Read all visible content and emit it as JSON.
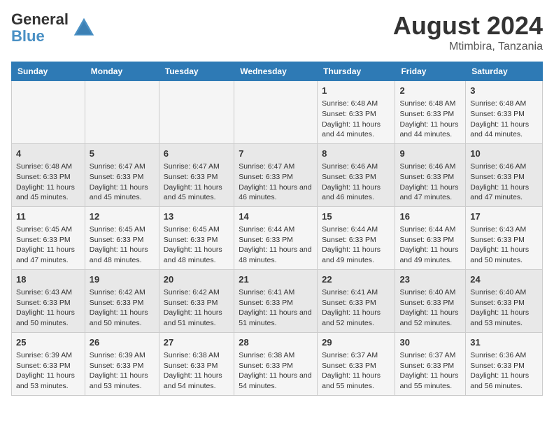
{
  "header": {
    "logo_line1": "General",
    "logo_line2": "Blue",
    "month_title": "August 2024",
    "location": "Mtimbira, Tanzania"
  },
  "days_of_week": [
    "Sunday",
    "Monday",
    "Tuesday",
    "Wednesday",
    "Thursday",
    "Friday",
    "Saturday"
  ],
  "weeks": [
    [
      {
        "day": "",
        "info": ""
      },
      {
        "day": "",
        "info": ""
      },
      {
        "day": "",
        "info": ""
      },
      {
        "day": "",
        "info": ""
      },
      {
        "day": "1",
        "info": "Sunrise: 6:48 AM\nSunset: 6:33 PM\nDaylight: 11 hours and 44 minutes."
      },
      {
        "day": "2",
        "info": "Sunrise: 6:48 AM\nSunset: 6:33 PM\nDaylight: 11 hours and 44 minutes."
      },
      {
        "day": "3",
        "info": "Sunrise: 6:48 AM\nSunset: 6:33 PM\nDaylight: 11 hours and 44 minutes."
      }
    ],
    [
      {
        "day": "4",
        "info": "Sunrise: 6:48 AM\nSunset: 6:33 PM\nDaylight: 11 hours and 45 minutes."
      },
      {
        "day": "5",
        "info": "Sunrise: 6:47 AM\nSunset: 6:33 PM\nDaylight: 11 hours and 45 minutes."
      },
      {
        "day": "6",
        "info": "Sunrise: 6:47 AM\nSunset: 6:33 PM\nDaylight: 11 hours and 45 minutes."
      },
      {
        "day": "7",
        "info": "Sunrise: 6:47 AM\nSunset: 6:33 PM\nDaylight: 11 hours and 46 minutes."
      },
      {
        "day": "8",
        "info": "Sunrise: 6:46 AM\nSunset: 6:33 PM\nDaylight: 11 hours and 46 minutes."
      },
      {
        "day": "9",
        "info": "Sunrise: 6:46 AM\nSunset: 6:33 PM\nDaylight: 11 hours and 47 minutes."
      },
      {
        "day": "10",
        "info": "Sunrise: 6:46 AM\nSunset: 6:33 PM\nDaylight: 11 hours and 47 minutes."
      }
    ],
    [
      {
        "day": "11",
        "info": "Sunrise: 6:45 AM\nSunset: 6:33 PM\nDaylight: 11 hours and 47 minutes."
      },
      {
        "day": "12",
        "info": "Sunrise: 6:45 AM\nSunset: 6:33 PM\nDaylight: 11 hours and 48 minutes."
      },
      {
        "day": "13",
        "info": "Sunrise: 6:45 AM\nSunset: 6:33 PM\nDaylight: 11 hours and 48 minutes."
      },
      {
        "day": "14",
        "info": "Sunrise: 6:44 AM\nSunset: 6:33 PM\nDaylight: 11 hours and 48 minutes."
      },
      {
        "day": "15",
        "info": "Sunrise: 6:44 AM\nSunset: 6:33 PM\nDaylight: 11 hours and 49 minutes."
      },
      {
        "day": "16",
        "info": "Sunrise: 6:44 AM\nSunset: 6:33 PM\nDaylight: 11 hours and 49 minutes."
      },
      {
        "day": "17",
        "info": "Sunrise: 6:43 AM\nSunset: 6:33 PM\nDaylight: 11 hours and 50 minutes."
      }
    ],
    [
      {
        "day": "18",
        "info": "Sunrise: 6:43 AM\nSunset: 6:33 PM\nDaylight: 11 hours and 50 minutes."
      },
      {
        "day": "19",
        "info": "Sunrise: 6:42 AM\nSunset: 6:33 PM\nDaylight: 11 hours and 50 minutes."
      },
      {
        "day": "20",
        "info": "Sunrise: 6:42 AM\nSunset: 6:33 PM\nDaylight: 11 hours and 51 minutes."
      },
      {
        "day": "21",
        "info": "Sunrise: 6:41 AM\nSunset: 6:33 PM\nDaylight: 11 hours and 51 minutes."
      },
      {
        "day": "22",
        "info": "Sunrise: 6:41 AM\nSunset: 6:33 PM\nDaylight: 11 hours and 52 minutes."
      },
      {
        "day": "23",
        "info": "Sunrise: 6:40 AM\nSunset: 6:33 PM\nDaylight: 11 hours and 52 minutes."
      },
      {
        "day": "24",
        "info": "Sunrise: 6:40 AM\nSunset: 6:33 PM\nDaylight: 11 hours and 53 minutes."
      }
    ],
    [
      {
        "day": "25",
        "info": "Sunrise: 6:39 AM\nSunset: 6:33 PM\nDaylight: 11 hours and 53 minutes."
      },
      {
        "day": "26",
        "info": "Sunrise: 6:39 AM\nSunset: 6:33 PM\nDaylight: 11 hours and 53 minutes."
      },
      {
        "day": "27",
        "info": "Sunrise: 6:38 AM\nSunset: 6:33 PM\nDaylight: 11 hours and 54 minutes."
      },
      {
        "day": "28",
        "info": "Sunrise: 6:38 AM\nSunset: 6:33 PM\nDaylight: 11 hours and 54 minutes."
      },
      {
        "day": "29",
        "info": "Sunrise: 6:37 AM\nSunset: 6:33 PM\nDaylight: 11 hours and 55 minutes."
      },
      {
        "day": "30",
        "info": "Sunrise: 6:37 AM\nSunset: 6:33 PM\nDaylight: 11 hours and 55 minutes."
      },
      {
        "day": "31",
        "info": "Sunrise: 6:36 AM\nSunset: 6:33 PM\nDaylight: 11 hours and 56 minutes."
      }
    ]
  ]
}
